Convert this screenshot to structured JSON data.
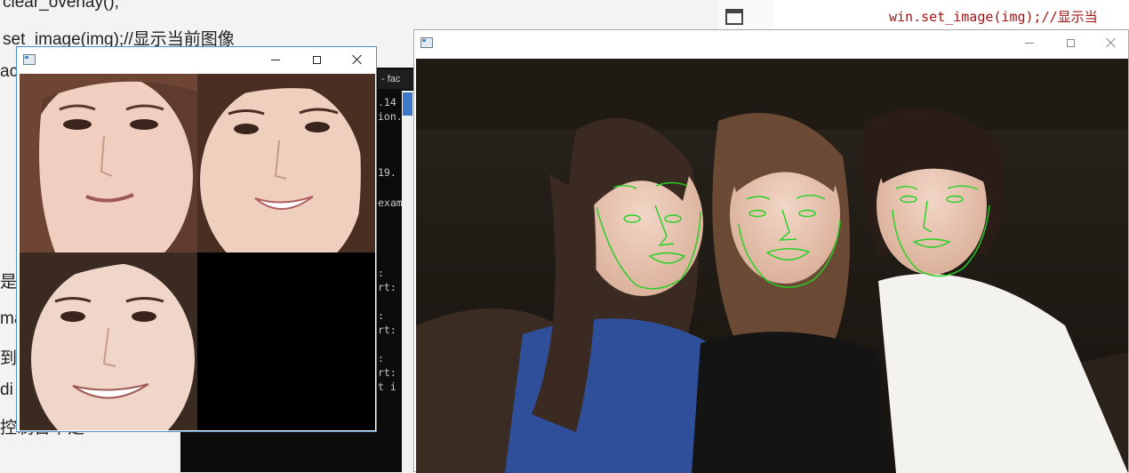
{
  "background_doc": {
    "lines": [
      "clear_overlay();",
      "set_image(img);//显示当前图像"
    ],
    "fragments": [
      "ac",
      "是不",
      "ma",
      "到.",
      "di",
      "控制台中是"
    ]
  },
  "console": {
    "tab_label": "- fac",
    "lines": [
      ".14",
      "ion.",
      "19.",
      "exam",
      ":",
      "rt:",
      ":",
      "rt:",
      ":",
      "rt:",
      "t i"
    ]
  },
  "editor": {
    "code_line": "win.set_image(img);//显示当"
  },
  "faces_window": {
    "title": "",
    "tiles": [
      "face-chip-1",
      "face-chip-2",
      "face-chip-3",
      "empty"
    ]
  },
  "photo_window": {
    "title": "",
    "overlay_color": "#22d022"
  },
  "colors": {
    "active_border": "#4a8ed1",
    "code_text": "#a31515",
    "landmark_green": "#22d022"
  }
}
